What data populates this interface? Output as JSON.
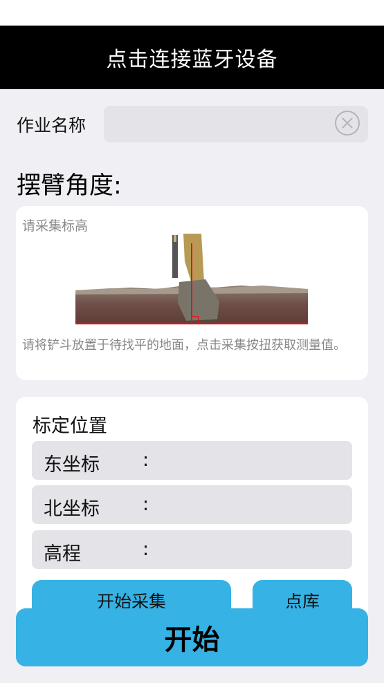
{
  "nav": {
    "title": "点击连接蓝牙设备"
  },
  "job": {
    "label": "作业名称",
    "value": "",
    "placeholder": ""
  },
  "arm_angle": {
    "title": "摆臂角度:"
  },
  "collect_card": {
    "prompt": "请采集标高",
    "instruction": "请将铲斗放置于待找平的地面，点击采集按扭获取测量值。"
  },
  "calibration": {
    "title": "标定位置",
    "fields": [
      {
        "label": "东坐标",
        "sep": ":",
        "value": ""
      },
      {
        "label": "北坐标",
        "sep": ":",
        "value": ""
      },
      {
        "label": "高程",
        "sep": ":",
        "value": ""
      }
    ],
    "buttons": {
      "start_collect": "开始采集",
      "point_library": "点库"
    }
  },
  "start_button": {
    "label": "开始"
  },
  "colors": {
    "accent": "#36b2e4",
    "nav_bg": "#000000",
    "page_bg": "#efeff4",
    "field_bg": "#e3e3e8"
  }
}
